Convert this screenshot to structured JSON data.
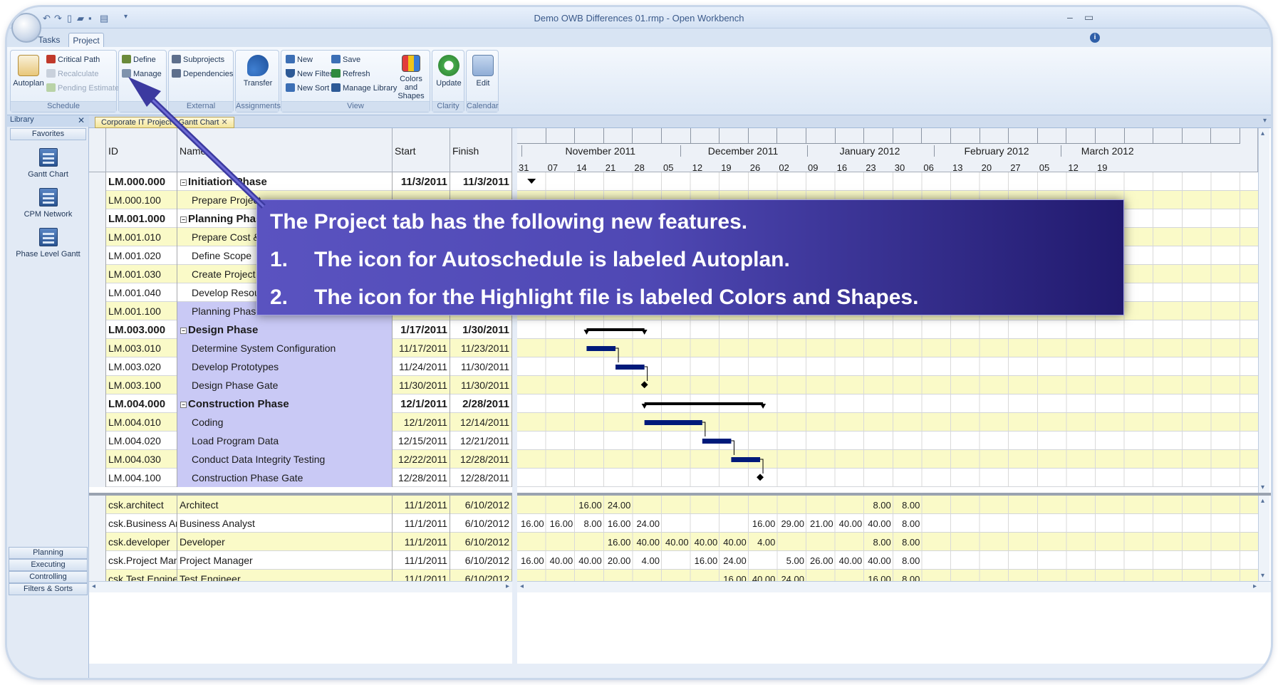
{
  "window": {
    "title": "Demo OWB Differences 01.rmp - Open Workbench"
  },
  "tabs": [
    {
      "label": "Tasks"
    },
    {
      "label": "Project"
    }
  ],
  "ribbon": {
    "autoplan": "Autoplan",
    "critical_path": "Critical Path",
    "recalculate": "Recalculate",
    "pending_estimates": "Pending Estimates",
    "schedule": "Schedule",
    "define": "Define",
    "manage": "Manage",
    "subprojects": "Subprojects",
    "dependencies": "Dependencies",
    "external": "External",
    "transfer": "Transfer",
    "assignments": "Assignments",
    "new": "New",
    "save": "Save",
    "new_filter": "New Filter",
    "refresh": "Refresh",
    "new_sort": "New Sort",
    "manage_library": "Manage Library",
    "view": "View",
    "colors_and_shapes_1": "Colors and",
    "colors_and_shapes_2": "Shapes",
    "update": "Update",
    "clarity": "Clarity",
    "edit": "Edit",
    "calendar": "Calendar"
  },
  "library": {
    "title": "Library",
    "favorites": "Favorites",
    "items": [
      {
        "label": "Gantt Chart"
      },
      {
        "label": "CPM Network"
      },
      {
        "label": "Phase Level Gantt"
      }
    ],
    "bottom": [
      {
        "label": "Planning"
      },
      {
        "label": "Executing"
      },
      {
        "label": "Controlling"
      },
      {
        "label": "Filters & Sorts"
      }
    ]
  },
  "doc_tab": {
    "label": "Corporate IT Project - Gantt Chart"
  },
  "columns": {
    "id": "ID",
    "name": "Name",
    "start": "Start",
    "finish": "Finish"
  },
  "timeline": {
    "months": [
      "November 2011",
      "December 2011",
      "January 2012",
      "February 2012",
      "March 2012"
    ],
    "weeks": [
      "31",
      "07",
      "14",
      "21",
      "28",
      "05",
      "12",
      "19",
      "26",
      "02",
      "09",
      "16",
      "23",
      "30",
      "06",
      "13",
      "20",
      "27",
      "05",
      "12",
      "19"
    ]
  },
  "tasks": [
    {
      "id": "LM.000.000",
      "name": "Initiation Phase",
      "start": "11/3/2011",
      "finish": "11/3/2011",
      "summary": true
    },
    {
      "id": "LM.000.100",
      "name": "Prepare Project",
      "start": "",
      "finish": "",
      "summary": false
    },
    {
      "id": "LM.001.000",
      "name": "Planning Phase",
      "start": "",
      "finish": "",
      "summary": true
    },
    {
      "id": "LM.001.010",
      "name": "Prepare Cost &",
      "start": "",
      "finish": "",
      "summary": false
    },
    {
      "id": "LM.001.020",
      "name": "Define Scope",
      "start": "",
      "finish": "",
      "summary": false
    },
    {
      "id": "LM.001.030",
      "name": "Create Project",
      "start": "",
      "finish": "",
      "summary": false
    },
    {
      "id": "LM.001.040",
      "name": "Develop Resour",
      "start": "",
      "finish": "",
      "summary": false
    },
    {
      "id": "LM.001.100",
      "name": "Planning Phase Gate",
      "start": "",
      "finish": "",
      "summary": false
    },
    {
      "id": "LM.003.000",
      "name": "Design Phase",
      "start": "1/17/2011",
      "finish": "1/30/2011",
      "summary": true
    },
    {
      "id": "LM.003.010",
      "name": "Determine System Configuration",
      "start": "11/17/2011",
      "finish": "11/23/2011",
      "summary": false
    },
    {
      "id": "LM.003.020",
      "name": "Develop Prototypes",
      "start": "11/24/2011",
      "finish": "11/30/2011",
      "summary": false
    },
    {
      "id": "LM.003.100",
      "name": "Design Phase Gate",
      "start": "11/30/2011",
      "finish": "11/30/2011",
      "summary": false
    },
    {
      "id": "LM.004.000",
      "name": "Construction Phase",
      "start": "12/1/2011",
      "finish": "2/28/2011",
      "summary": true
    },
    {
      "id": "LM.004.010",
      "name": "Coding",
      "start": "12/1/2011",
      "finish": "12/14/2011",
      "summary": false
    },
    {
      "id": "LM.004.020",
      "name": "Load Program Data",
      "start": "12/15/2011",
      "finish": "12/21/2011",
      "summary": false
    },
    {
      "id": "LM.004.030",
      "name": "Conduct Data Integrity Testing",
      "start": "12/22/2011",
      "finish": "12/28/2011",
      "summary": false
    },
    {
      "id": "LM.004.100",
      "name": "Construction Phase Gate",
      "start": "12/28/2011",
      "finish": "12/28/2011",
      "summary": false
    }
  ],
  "resources": [
    {
      "id": "csk.architect",
      "name": "Architect",
      "start": "11/1/2011",
      "finish": "6/10/2012",
      "hours": [
        "",
        "",
        "16.00",
        "24.00",
        "",
        "",
        "",
        "",
        "",
        "",
        "",
        "",
        "8.00",
        "8.00",
        "",
        "",
        "",
        "",
        "",
        ""
      ]
    },
    {
      "id": "csk.Business Anal",
      "name": "Business Analyst",
      "start": "11/1/2011",
      "finish": "6/10/2012",
      "hours": [
        "16.00",
        "16.00",
        "8.00",
        "16.00",
        "24.00",
        "",
        "",
        "",
        "16.00",
        "29.00",
        "21.00",
        "40.00",
        "40.00",
        "8.00",
        "",
        "",
        "",
        "",
        "",
        ""
      ]
    },
    {
      "id": "csk.developer",
      "name": "Developer",
      "start": "11/1/2011",
      "finish": "6/10/2012",
      "hours": [
        "",
        "",
        "",
        "16.00",
        "40.00",
        "40.00",
        "40.00",
        "40.00",
        "4.00",
        "",
        "",
        "",
        "8.00",
        "8.00",
        "",
        "",
        "",
        "",
        "",
        ""
      ]
    },
    {
      "id": "csk.Project Mana",
      "name": "Project Manager",
      "start": "11/1/2011",
      "finish": "6/10/2012",
      "hours": [
        "16.00",
        "40.00",
        "40.00",
        "20.00",
        "4.00",
        "",
        "16.00",
        "24.00",
        "",
        "5.00",
        "26.00",
        "40.00",
        "40.00",
        "8.00",
        "",
        "",
        "",
        "",
        "",
        ""
      ]
    },
    {
      "id": "csk.Test Engineer",
      "name": "Test Engineer",
      "start": "11/1/2011",
      "finish": "6/10/2012",
      "hours": [
        "",
        "",
        "",
        "",
        "",
        "",
        "",
        "16.00",
        "40.00",
        "24.00",
        "",
        "",
        "16.00",
        "8.00",
        "",
        "",
        "",
        "",
        "",
        ""
      ]
    }
  ],
  "callout": {
    "line1": "The Project tab has the following new features.",
    "n1": "1.",
    "item1": "The icon for Autoschedule is labeled Autoplan.",
    "n2": "2.",
    "item2": "The icon for the Highlight file is labeled Colors and Shapes."
  },
  "colors": {
    "accent": "#4f48b4",
    "row_yellow": "#fafac8",
    "summary_purple": "#c9c9f5",
    "bar": "#001a7a"
  }
}
